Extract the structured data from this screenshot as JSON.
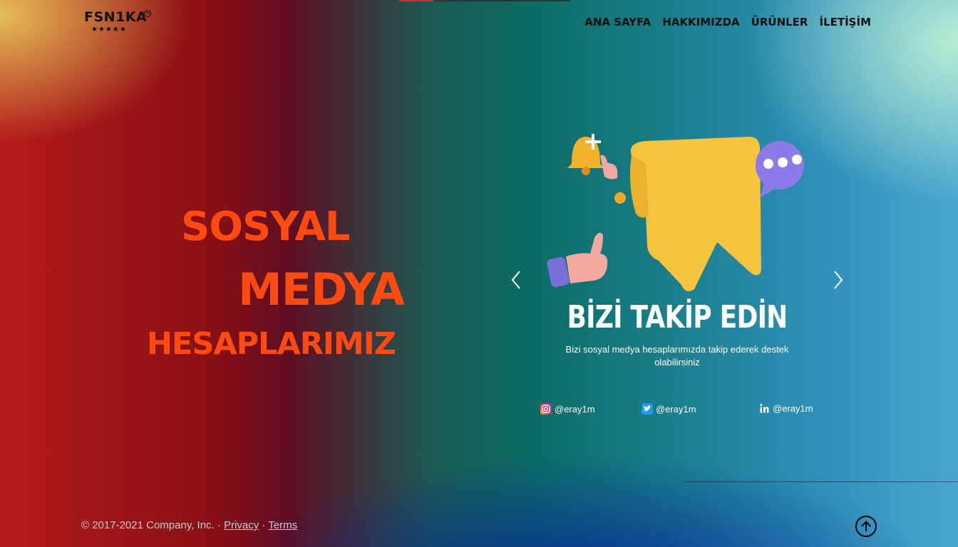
{
  "brand": {
    "logo_text": "FSN1KA",
    "logo_mark": "TM",
    "stars": "★★★★★"
  },
  "nav": {
    "items": [
      "ANA SAYFA",
      "HAKKIMIZDA",
      "ÜRÜNLER",
      "İLETİŞİM"
    ]
  },
  "hero": {
    "line1": "SOSYAL",
    "line2": "MEDYA",
    "line3": "HESAPLARIMIZ"
  },
  "carousel": {
    "title": "BİZİ TAKİP EDİN",
    "subtitle": "Bizi sosyal medya hesaplarımızda takip ederek destek olabilirsiniz",
    "socials": [
      {
        "icon": "instagram-icon",
        "handle": "@eray1m"
      },
      {
        "icon": "twitter-icon",
        "handle": "@eray1m"
      },
      {
        "icon": "linkedin-icon",
        "handle": "@eray1m"
      }
    ]
  },
  "footer": {
    "copyright": "© 2017-2021 Company, Inc. ·",
    "separator": "·",
    "privacy": "Privacy",
    "terms": "Terms"
  },
  "colors": {
    "hero_text": "#ff4a12",
    "nav_text": "#101010"
  }
}
